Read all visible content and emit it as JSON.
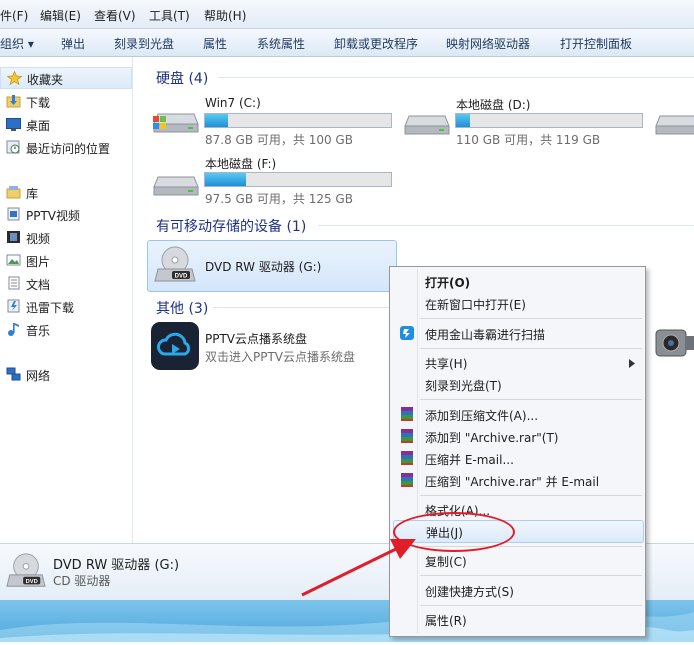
{
  "menubar": {
    "items": [
      "件(F)",
      "编辑(E)",
      "查看(V)",
      "工具(T)",
      "帮助(H)"
    ]
  },
  "toolbar": {
    "items": [
      "组织 ▾",
      "弹出",
      "刻录到光盘",
      "属性",
      "系统属性",
      "卸载或更改程序",
      "映射网络驱动器",
      "打开控制面板"
    ]
  },
  "nav": {
    "items": [
      {
        "label": "收藏夹",
        "icon": "star-icon"
      },
      {
        "label": "下载",
        "icon": "folder-download-icon"
      },
      {
        "label": "桌面",
        "icon": "desktop-icon"
      },
      {
        "label": "最近访问的位置",
        "icon": "recent-places-icon"
      },
      {
        "label": "库",
        "icon": "library-icon"
      },
      {
        "label": "PPTV视频",
        "icon": "pptv-video-icon"
      },
      {
        "label": "视频",
        "icon": "video-icon"
      },
      {
        "label": "图片",
        "icon": "pictures-icon"
      },
      {
        "label": "文档",
        "icon": "documents-icon"
      },
      {
        "label": "迅雷下载",
        "icon": "thunder-download-icon"
      },
      {
        "label": "音乐",
        "icon": "music-icon"
      },
      {
        "label": "网络",
        "icon": "network-icon"
      }
    ]
  },
  "groups": {
    "hdd": {
      "title": "硬盘 (4)"
    },
    "removable": {
      "title": "有可移动存储的设备 (1)"
    },
    "other": {
      "title": "其他 (3)"
    }
  },
  "drives": [
    {
      "name": "Win7 (C:)",
      "free": "87.8 GB 可用，共 100 GB",
      "used_fraction": 0.122
    },
    {
      "name": "本地磁盘 (D:)",
      "free": "110 GB 可用，共 119 GB",
      "used_fraction": 0.076
    },
    {
      "name": "本地磁盘 (F:)",
      "free": "97.5 GB 可用，共 125 GB",
      "used_fraction": 0.22
    }
  ],
  "dvd": {
    "name": "DVD RW 驱动器 (G:)",
    "badge": "DVD"
  },
  "other_item": {
    "name": "PPTV云点播系统盘",
    "sub": "双击进入PPTV云点播系统盘"
  },
  "details": {
    "name": "DVD RW 驱动器 (G:)",
    "type": "CD 驱动器",
    "badge": "DVD"
  },
  "context_menu": {
    "open": "打开(O)",
    "open_new_window": "在新窗口中打开(E)",
    "scan": "使用金山毒霸进行扫描",
    "share": "共享(H)",
    "burn": "刻录到光盘(T)",
    "add_archive": "添加到压缩文件(A)...",
    "add_rar": "添加到 \"Archive.rar\"(T)",
    "compress_email": "压缩并 E-mail...",
    "compress_rar_email": "压缩到 \"Archive.rar\" 并 E-mail",
    "format": "格式化(A)...",
    "eject": "弹出(J)",
    "copy": "复制(C)",
    "create_shortcut": "创建快捷方式(S)",
    "properties": "属性(R)"
  },
  "colors": {
    "accent": "#1e3287",
    "highlight": "#dceaf9",
    "annotation_red": "#e01e2a",
    "bar_fill": "#26a0da"
  }
}
